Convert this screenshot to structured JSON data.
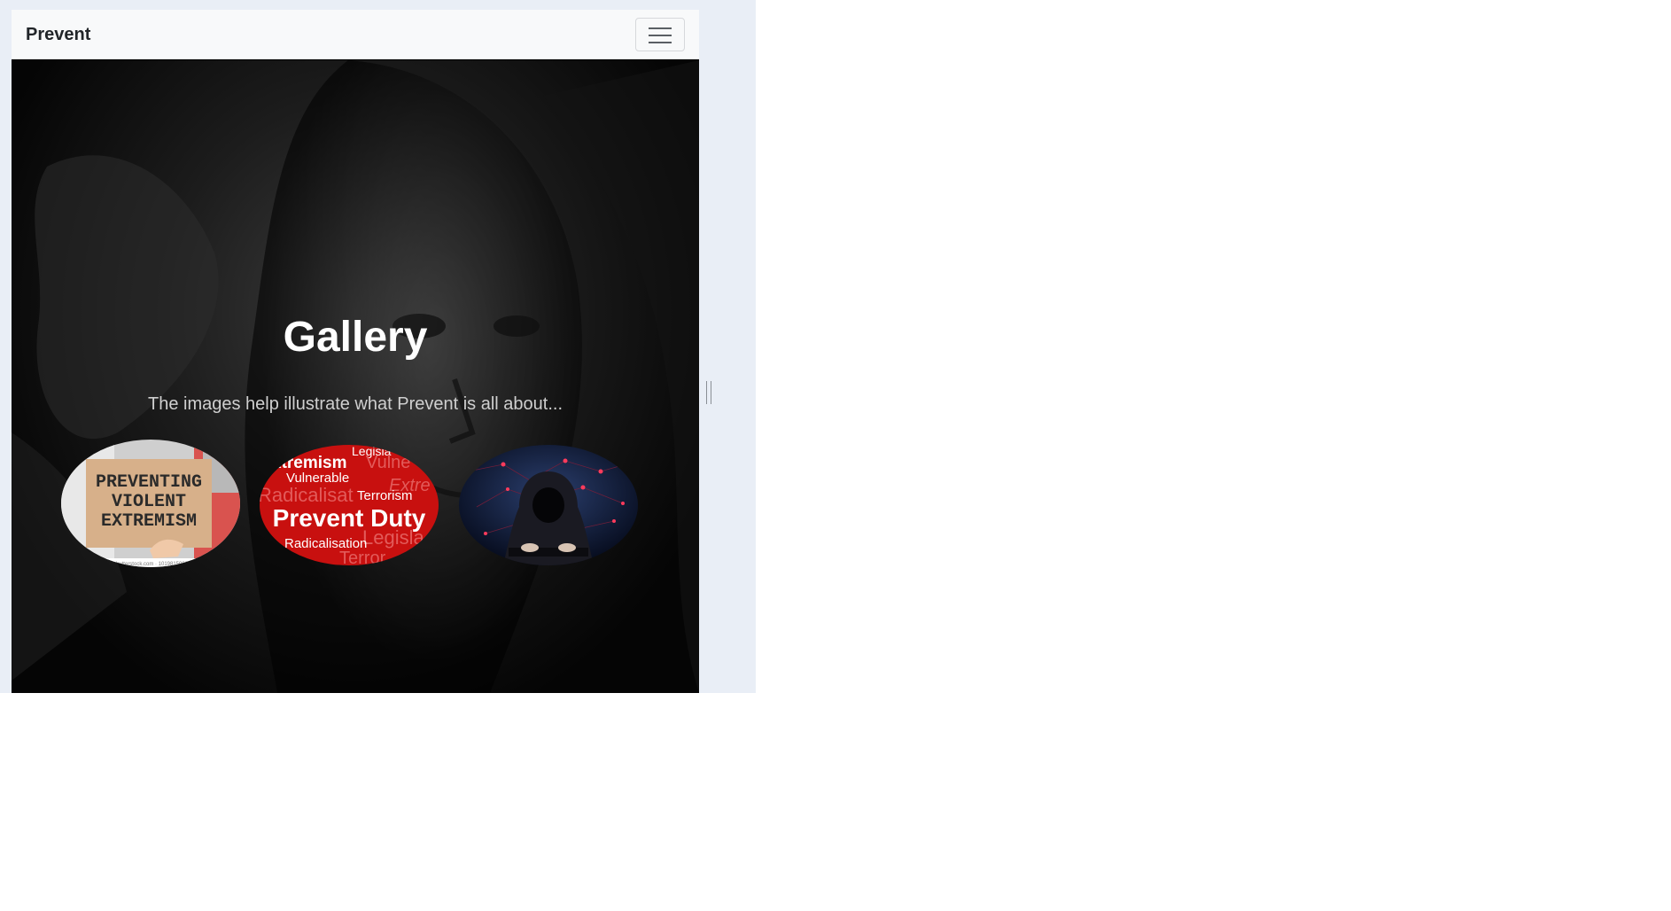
{
  "navbar": {
    "brand": "Prevent",
    "toggle_icon": "hamburger-menu-icon"
  },
  "hero": {
    "title": "Gallery",
    "subtitle": "The images help illustrate what Prevent is all about..."
  },
  "gallery": {
    "images": [
      {
        "name": "preventing-violent-extremism-sign",
        "lines": [
          "PREVENTING",
          "VIOLENT",
          "EXTREMISM"
        ],
        "watermark": "shutterstock.com · 1019815990"
      },
      {
        "name": "prevent-duty-word-cloud",
        "headline": "Prevent Duty",
        "words": [
          "Legisla",
          "xtremism",
          "Vulne",
          "Vulnerable",
          "Extre",
          "Radicalisat",
          "Terrorism",
          "Radicalisation",
          "Legisla",
          "Terror"
        ]
      },
      {
        "name": "hooded-hacker"
      }
    ]
  },
  "colors": {
    "navbar_bg": "#f8f9fa",
    "hero_bg": "#000000",
    "title": "#ffffff",
    "subtitle": "#cfcfcf",
    "word_cloud_red": "#c8100f"
  }
}
